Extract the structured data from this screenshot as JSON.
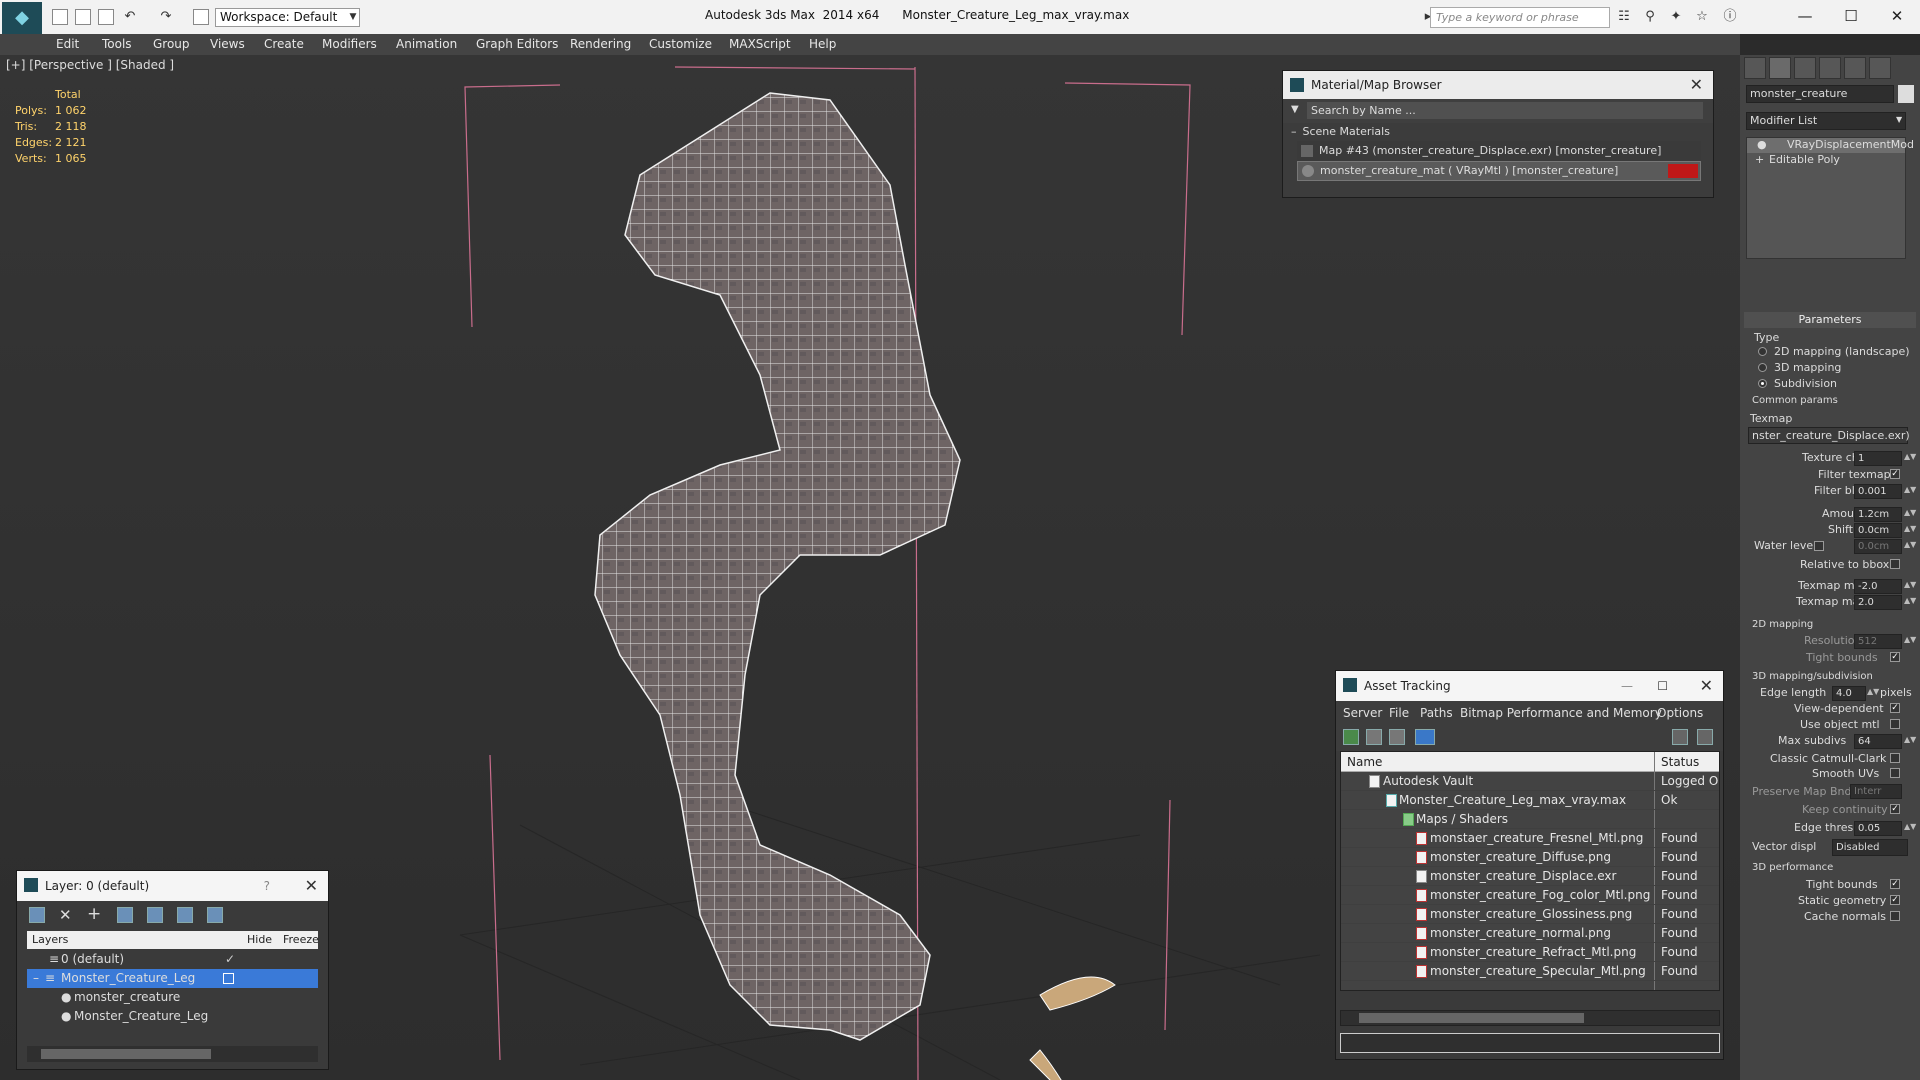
{
  "titlebar": {
    "workspace": "Workspace: Default",
    "app_name": "Autodesk 3ds Max  2014 x64",
    "file_name": "Monster_Creature_Leg_max_vray.max",
    "search_placeholder": "Type a keyword or phrase"
  },
  "menu": [
    "Edit",
    "Tools",
    "Group",
    "Views",
    "Create",
    "Modifiers",
    "Animation",
    "Graph Editors",
    "Rendering",
    "Customize",
    "MAXScript",
    "Help"
  ],
  "viewport": {
    "label": "[+] [Perspective ] [Shaded ]",
    "stats_header": "Total",
    "stats": [
      {
        "label": "Polys:",
        "value": "1 062"
      },
      {
        "label": "Tris:",
        "value": "2 118"
      },
      {
        "label": "Edges:",
        "value": "2 121"
      },
      {
        "label": "Verts:",
        "value": "1 065"
      }
    ]
  },
  "material_browser": {
    "title": "Material/Map Browser",
    "search_placeholder": "Search by Name ...",
    "section": "Scene Materials",
    "items": [
      "Map #43 (monster_creature_Displace.exr)  [monster_creature]",
      "monster_creature_mat  ( VRayMtl )  [monster_creature]"
    ]
  },
  "asset_tracking": {
    "title": "Asset Tracking",
    "menu": [
      "Server",
      "File",
      "Paths",
      "Bitmap Performance and Memory",
      "Options"
    ],
    "col_name": "Name",
    "col_status": "Status",
    "rows": [
      {
        "name": "Autodesk Vault",
        "status": "Logged Out"
      },
      {
        "name": "Monster_Creature_Leg_max_vray.max",
        "status": "Ok"
      },
      {
        "name": "Maps / Shaders",
        "status": ""
      },
      {
        "name": "monstaer_creature_Fresnel_Mtl.png",
        "status": "Found"
      },
      {
        "name": "monster_creature_Diffuse.png",
        "status": "Found"
      },
      {
        "name": "monster_creature_Displace.exr",
        "status": "Found"
      },
      {
        "name": "monster_creature_Fog_color_Mtl.png",
        "status": "Found"
      },
      {
        "name": "monster_creature_Glossiness.png",
        "status": "Found"
      },
      {
        "name": "monster_creature_normal.png",
        "status": "Found"
      },
      {
        "name": "monster_creature_Refract_Mtl.png",
        "status": "Found"
      },
      {
        "name": "monster_creature_Specular_Mtl.png",
        "status": "Found"
      }
    ]
  },
  "layer_panel": {
    "title": "Layer: 0 (default)",
    "col_layers": "Layers",
    "col_hide": "Hide",
    "col_freeze": "Freeze",
    "rows": [
      "0 (default)",
      "Monster_Creature_Leg",
      "monster_creature",
      "Monster_Creature_Leg"
    ]
  },
  "command_panel": {
    "object_name": "monster_creature",
    "modifier_list": "Modifier List",
    "stack": [
      "VRayDisplacementMod",
      "Editable Poly"
    ],
    "rollout": "Parameters",
    "type_label": "Type",
    "type_options": [
      "2D mapping (landscape)",
      "3D mapping",
      "Subdivision"
    ],
    "common_params": "Common params",
    "texmap_label": "Texmap",
    "texmap_value": "nster_creature_Displace.exr)",
    "texture_chan_label": "Texture chan",
    "texture_chan": "1",
    "filter_texmap": "Filter texmap",
    "filter_blur_label": "Filter blur",
    "filter_blur": "0.001",
    "amount_label": "Amount",
    "amount": "1.2cm",
    "shift_label": "Shift",
    "shift": "0.0cm",
    "water_level_label": "Water level",
    "water_level": "0.0cm",
    "relative_bbox": "Relative to bbox",
    "texmap_min_label": "Texmap min",
    "texmap_min": "-2.0",
    "texmap_max_label": "Texmap max",
    "texmap_max": "2.0",
    "mapping_2d": "2D mapping",
    "resolution_label": "Resolution",
    "resolution": "512",
    "tight_bounds": "Tight bounds",
    "mapping_3d": "3D mapping/subdivision",
    "edge_length_label": "Edge length",
    "edge_length": "4.0",
    "pixels": "pixels",
    "view_dependent": "View-dependent",
    "use_object_mtl": "Use object mtl",
    "max_subdivs_label": "Max subdivs",
    "max_subdivs": "64",
    "classic_catmull": "Classic Catmull-Clark",
    "smooth_uvs": "Smooth UVs",
    "preserve_map_bnd": "Preserve Map Bnd",
    "preserve_map_value": "Interr",
    "keep_continuity": "Keep continuity",
    "edge_thresh_label": "Edge thresh",
    "edge_thresh": "0.05",
    "vector_displ_label": "Vector displ",
    "vector_displ": "Disabled",
    "perf_3d": "3D performance",
    "tight_bounds2": "Tight bounds",
    "static_geometry": "Static geometry",
    "cache_normals": "Cache normals"
  }
}
